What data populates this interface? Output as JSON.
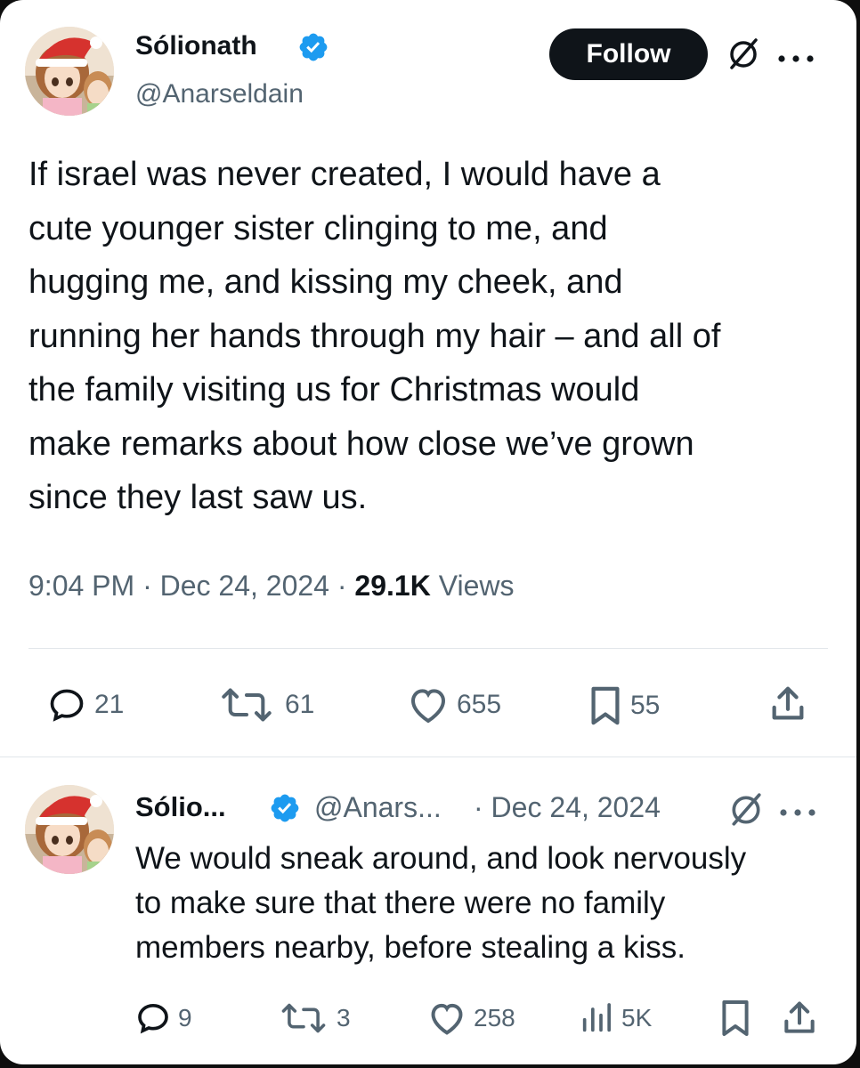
{
  "tweet": {
    "author": {
      "display_name": "Sólionath",
      "handle": "@Anarseldain",
      "avatar_icon": "anime-avatar-santa-hat-icon",
      "verified_icon": "verified-badge-icon"
    },
    "follow_label": "Follow",
    "grok_icon": "grok-icon",
    "more_icon": "more-options-icon",
    "text": "If israel was never created, I would have a\ncute younger sister clinging to me, and\nhugging me, and kissing my cheek, and\nrunning her hands through my hair – and all of\nthe family visiting us for Christmas would\nmake remarks about how close we’ve grown\nsince they last saw us.",
    "time": "9:04 PM",
    "date": "Dec 24, 2024",
    "views": "29.1K",
    "views_label": "Views",
    "actions": {
      "replies": "21",
      "reposts": "61",
      "likes": "655",
      "bookmarks": "55"
    }
  },
  "reply": {
    "author": {
      "display_name": "Sólio...",
      "handle": "@Anars...",
      "avatar_icon": "anime-avatar-santa-hat-icon",
      "verified_icon": "verified-badge-icon"
    },
    "date": "· Dec 24, 2024",
    "text": "We would sneak around, and look nervously\nto make sure that there were no family\nmembers nearby, before stealing a kiss.",
    "actions": {
      "replies": "9",
      "reposts": "3",
      "likes": "258",
      "views": "5K"
    }
  },
  "colors": {
    "text_primary": "#0f1419",
    "text_secondary": "#536471",
    "verified": "#1d9bf0",
    "follow_bg": "#0f1419"
  }
}
